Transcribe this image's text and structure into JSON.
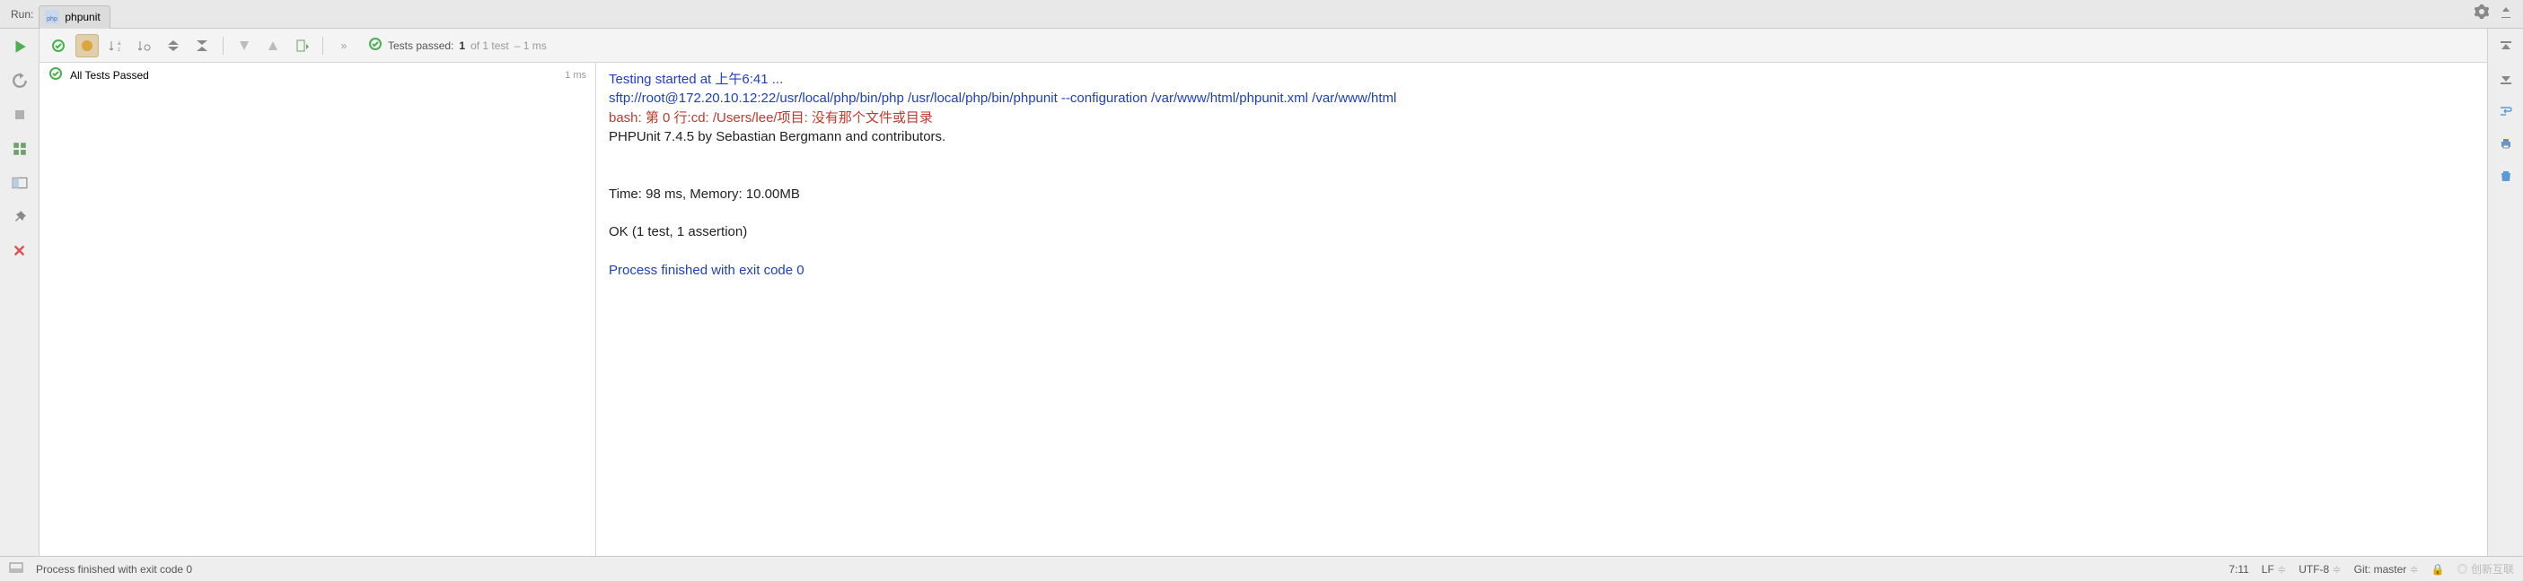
{
  "topbar": {
    "run_label": "Run:",
    "tab_name": "phpunit"
  },
  "toolbar": {
    "summary_prefix": "Tests passed:",
    "summary_passed": "1",
    "summary_total": "of 1 test",
    "summary_time": "– 1 ms"
  },
  "tree": {
    "root_label": "All Tests Passed",
    "root_time": "1 ms"
  },
  "console": {
    "line1": "Testing started at 上午6:41 ...",
    "line2": "sftp://root@172.20.10.12:22/usr/local/php/bin/php /usr/local/php/bin/phpunit --configuration /var/www/html/phpunit.xml /var/www/html",
    "line3": "bash: 第 0 行:cd: /Users/lee/项目: 没有那个文件或目录",
    "line4": "PHPUnit 7.4.5 by Sebastian Bergmann and contributors.",
    "line5": "",
    "line6": "",
    "line7": "Time: 98 ms, Memory: 10.00MB",
    "line8": "",
    "line9": "OK (1 test, 1 assertion)",
    "line10": "",
    "line11": "Process finished with exit code 0"
  },
  "status": {
    "msg": "Process finished with exit code 0",
    "caret": "7:11",
    "le": "LF",
    "enc": "UTF-8",
    "git": "Git: master",
    "lock": "🔒"
  }
}
